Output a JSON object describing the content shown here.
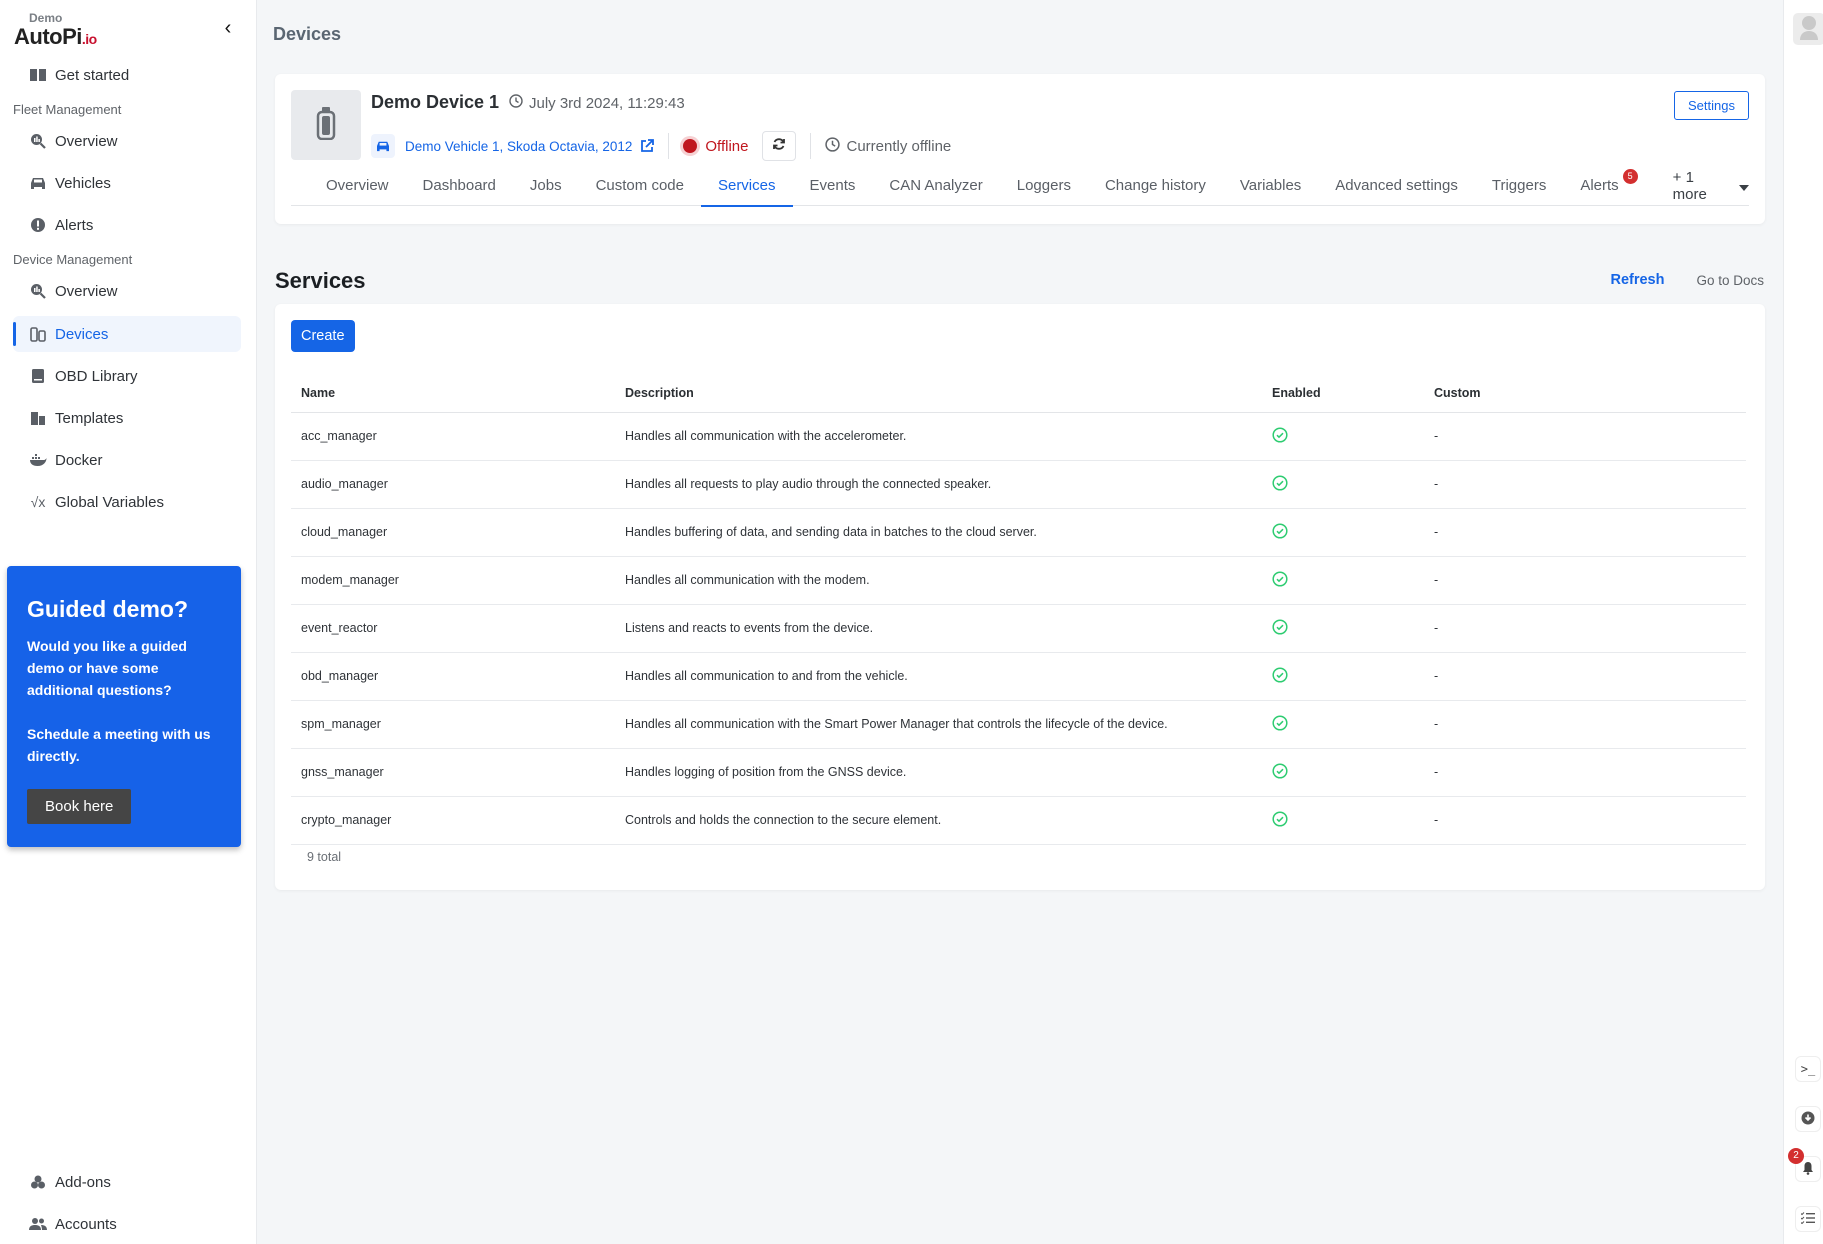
{
  "brand": {
    "demo_label": "Demo",
    "name_a": "AutoPi",
    "name_b": ".io"
  },
  "sidebar": {
    "get_started": "Get started",
    "fleet_section": "Fleet Management",
    "fleet_items": [
      {
        "label": "Overview",
        "icon": "chart-search-icon"
      },
      {
        "label": "Vehicles",
        "icon": "car-icon"
      },
      {
        "label": "Alerts",
        "icon": "alert-circle-icon"
      }
    ],
    "device_section": "Device Management",
    "device_items": [
      {
        "label": "Overview",
        "icon": "chart-search-icon"
      },
      {
        "label": "Devices",
        "icon": "devices-icon",
        "active": true
      },
      {
        "label": "OBD Library",
        "icon": "book-icon"
      },
      {
        "label": "Templates",
        "icon": "templates-icon"
      },
      {
        "label": "Docker",
        "icon": "docker-icon"
      },
      {
        "label": "Global Variables",
        "icon": "sqrt-x-icon"
      }
    ],
    "bottom_items": [
      {
        "label": "Add-ons",
        "icon": "addons-icon"
      },
      {
        "label": "Accounts",
        "icon": "users-icon"
      }
    ],
    "promo": {
      "title": "Guided demo?",
      "text1": "Would you like a guided demo or have some additional questions?",
      "text2": "Schedule a meeting with us directly.",
      "button": "Book here"
    }
  },
  "page": {
    "title": "Devices"
  },
  "device": {
    "name": "Demo Device 1",
    "timestamp": "July 3rd 2024, 11:29:43",
    "vehicle": "Demo Vehicle 1, Skoda Octavia, 2012",
    "status": "Offline",
    "status_color": "#c0161e",
    "connection": "Currently offline",
    "settings_label": "Settings"
  },
  "tabs": [
    {
      "label": "Overview"
    },
    {
      "label": "Dashboard"
    },
    {
      "label": "Jobs"
    },
    {
      "label": "Custom code"
    },
    {
      "label": "Services",
      "active": true
    },
    {
      "label": "Events"
    },
    {
      "label": "CAN Analyzer"
    },
    {
      "label": "Loggers"
    },
    {
      "label": "Change history"
    },
    {
      "label": "Variables"
    },
    {
      "label": "Advanced settings"
    },
    {
      "label": "Triggers"
    },
    {
      "label": "Alerts",
      "badge": "5"
    }
  ],
  "tabs_more": "+ 1 more",
  "services": {
    "title": "Services",
    "refresh_label": "Refresh",
    "docs_label": "Go to Docs",
    "create_label": "Create",
    "columns": [
      "Name",
      "Description",
      "Enabled",
      "Custom"
    ],
    "rows": [
      {
        "name": "acc_manager",
        "description": "Handles all communication with the accelerometer.",
        "enabled": true,
        "custom": "-"
      },
      {
        "name": "audio_manager",
        "description": "Handles all requests to play audio through the connected speaker.",
        "enabled": true,
        "custom": "-"
      },
      {
        "name": "cloud_manager",
        "description": "Handles buffering of data, and sending data in batches to the cloud server.",
        "enabled": true,
        "custom": "-"
      },
      {
        "name": "modem_manager",
        "description": "Handles all communication with the modem.",
        "enabled": true,
        "custom": "-"
      },
      {
        "name": "event_reactor",
        "description": "Listens and reacts to events from the device.",
        "enabled": true,
        "custom": "-"
      },
      {
        "name": "obd_manager",
        "description": "Handles all communication to and from the vehicle.",
        "enabled": true,
        "custom": "-"
      },
      {
        "name": "spm_manager",
        "description": "Handles all communication with the Smart Power Manager that controls the lifecycle of the device.",
        "enabled": true,
        "custom": "-"
      },
      {
        "name": "gnss_manager",
        "description": "Handles logging of position from the GNSS device.",
        "enabled": true,
        "custom": "-"
      },
      {
        "name": "crypto_manager",
        "description": "Controls and holds the connection to the secure element.",
        "enabled": true,
        "custom": "-"
      }
    ],
    "total_label": "9 total"
  },
  "right_rail": {
    "notifications_badge": "2"
  },
  "colors": {
    "accent": "#1565e6",
    "enabled_green": "#2ecc71",
    "badge_red": "#d32f2f"
  }
}
